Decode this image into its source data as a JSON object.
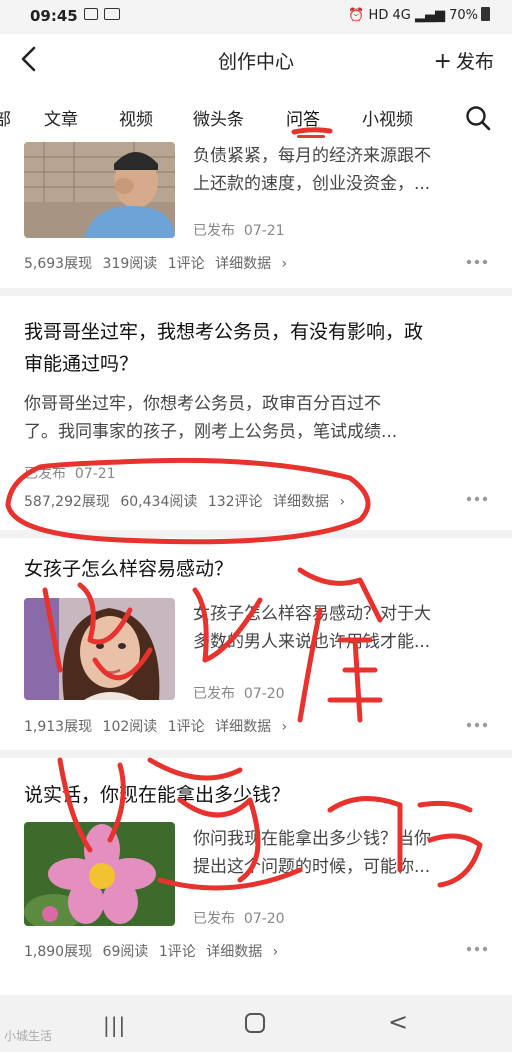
{
  "status": {
    "time": "09:45",
    "signal_text": "HD 4G",
    "battery": "70%"
  },
  "header": {
    "title": "创作中心",
    "publish_label": "发布",
    "publish_plus": "+"
  },
  "tabs": [
    "部",
    "文章",
    "视频",
    "微头条",
    "问答",
    "小视频"
  ],
  "active_tab": "问答",
  "items": [
    {
      "snippet": [
        "负债紧紧，每月的经济来源跟不",
        "上还款的速度，创业没资金，..."
      ],
      "status": "已发布",
      "date": "07-21",
      "views": "5,693展现",
      "reads": "319阅读",
      "comments": "1评论",
      "detail": "详细数据"
    },
    {
      "title": "我哥哥坐过牢，我想考公务员，有没有影响，政审能通过吗？",
      "title_lines": [
        "我哥哥坐过牢，我想考公务员，有没有影响，政",
        "审能通过吗？"
      ],
      "snippet": [
        "你哥哥坐过牢，你想考公务员，政审百分百过不",
        "了。我同事家的孩子，刚考上公务员，笔试成绩..."
      ],
      "status": "已发布",
      "date": "07-21",
      "views": "587,292展现",
      "reads": "60,434阅读",
      "comments": "132评论",
      "detail": "详细数据"
    },
    {
      "title": "女孩子怎么样容易感动？",
      "snippet": [
        "女孩子怎么样容易感动？对于大",
        "多数的男人来说也许用钱才能..."
      ],
      "status": "已发布",
      "date": "07-20",
      "views": "1,913展现",
      "reads": "102阅读",
      "comments": "1评论",
      "detail": "详细数据"
    },
    {
      "title": "说实话，你现在能拿出多少钱？",
      "snippet": [
        "你问我现在能拿出多少钱？当你",
        "提出这个问题的时候，可能你..."
      ],
      "status": "已发布",
      "date": "07-20",
      "views": "1,890展现",
      "reads": "69阅读",
      "comments": "1评论",
      "detail": "详细数据"
    }
  ],
  "nav": {
    "recent": "|||",
    "back": "<"
  },
  "watermark": "小城生活",
  "colors": {
    "accent": "#e53935",
    "divider": "#f2f2f2"
  }
}
